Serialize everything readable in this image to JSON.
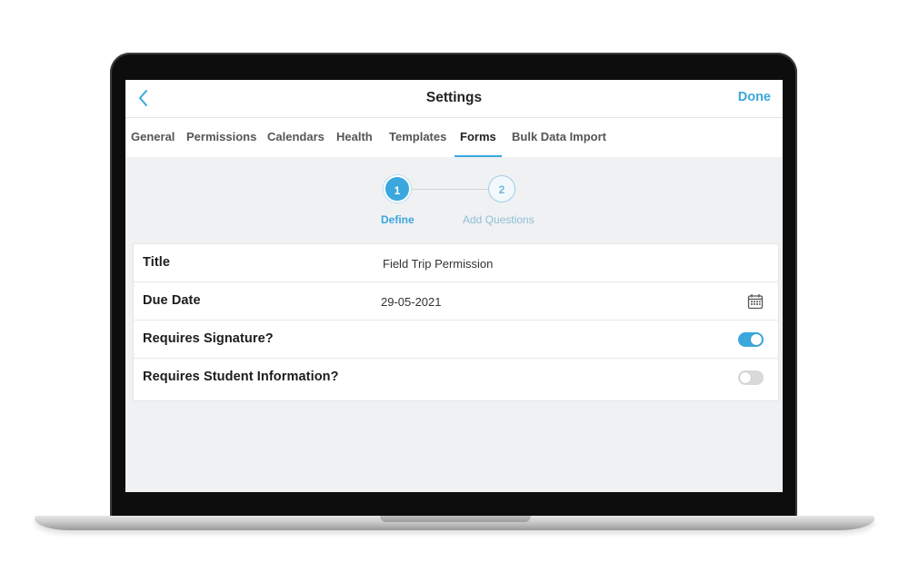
{
  "nav": {
    "title": "Settings",
    "done_label": "Done"
  },
  "tabs": [
    {
      "label": "General"
    },
    {
      "label": "Permissions"
    },
    {
      "label": "Calendars"
    },
    {
      "label": "Health"
    },
    {
      "label": "Templates"
    },
    {
      "label": "Forms",
      "active": true
    },
    {
      "label": "Bulk Data Import"
    }
  ],
  "stepper": {
    "steps": [
      {
        "number": "1",
        "label": "Define",
        "state": "active"
      },
      {
        "number": "2",
        "label": "Add Questions",
        "state": "inactive"
      }
    ]
  },
  "form": {
    "title_label": "Title",
    "title_value": "Field Trip Permission",
    "due_date_label": "Due Date",
    "due_date_value": "29-05-2021",
    "requires_signature_label": "Requires Signature?",
    "requires_signature_on": true,
    "requires_student_info_label": "Requires Student Information?",
    "requires_student_info_on": false
  },
  "icons": [
    "chevron-left-icon",
    "calendar-icon"
  ],
  "colors": {
    "accent": "#3aa7dd",
    "background": "#f0f1f3",
    "toggle_off": "#d9d9db"
  }
}
